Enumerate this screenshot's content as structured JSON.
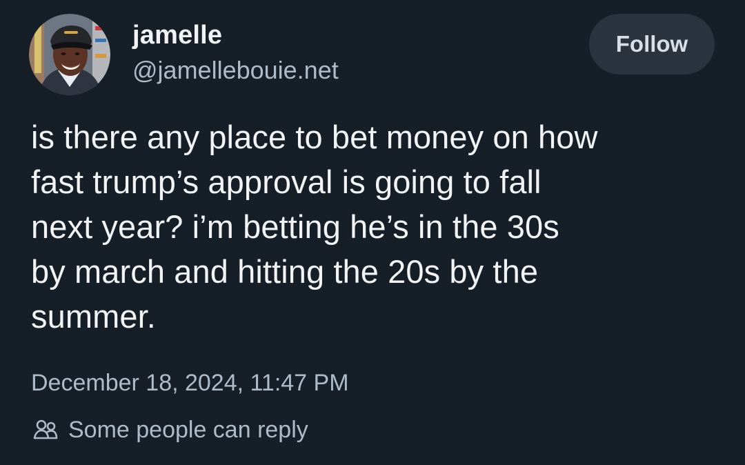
{
  "author": {
    "display_name": "jamelle",
    "handle": "@jamellebouie.net"
  },
  "header": {
    "follow_label": "Follow"
  },
  "post": {
    "text": "is there any place to bet money on how\nfast trump’s approval is going to fall\nnext year? i’m betting he’s in the 30s\nby march and hitting the 20s by the\nsummer.",
    "timestamp": "December 18, 2024, 11:47 PM",
    "reply_setting": "Some people can reply"
  },
  "icons": {
    "reply_setting_icon": "people-icon"
  },
  "colors": {
    "background": "#161e27",
    "follow_button": "#2a333e",
    "secondary_text": "#aebbc9"
  }
}
